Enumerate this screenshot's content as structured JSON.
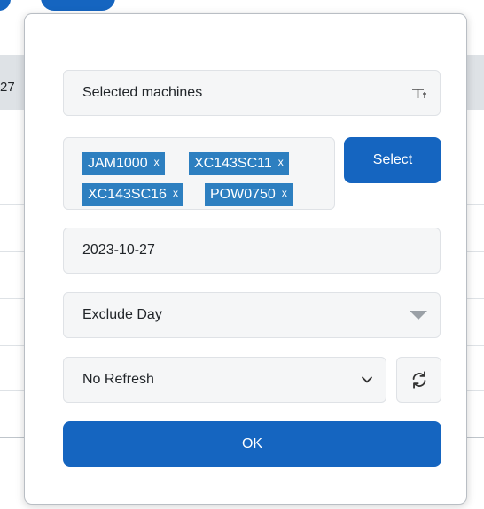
{
  "background": {
    "cell_text": "27"
  },
  "dialog": {
    "machines_filter_placeholder": "Selected machines",
    "selected_machines": [
      "JAM1000",
      "XC143SC11",
      "XC143SC16",
      "POW0750"
    ],
    "tag_remove_symbol": "x",
    "select_button_label": "Select",
    "date_value": "2023-10-27",
    "exclude_option": "Exclude Day",
    "refresh_option": "No Refresh",
    "ok_label": "OK"
  },
  "icons": {
    "filter": "filter-clear-icon",
    "caret": "caret-down-icon",
    "chevron": "chevron-down-icon",
    "refresh": "refresh-icon"
  },
  "colors": {
    "primary": "#1565c0",
    "tag": "#2d7fc0",
    "field_bg": "#f5f6f7",
    "field_border": "#dfe2e6"
  }
}
